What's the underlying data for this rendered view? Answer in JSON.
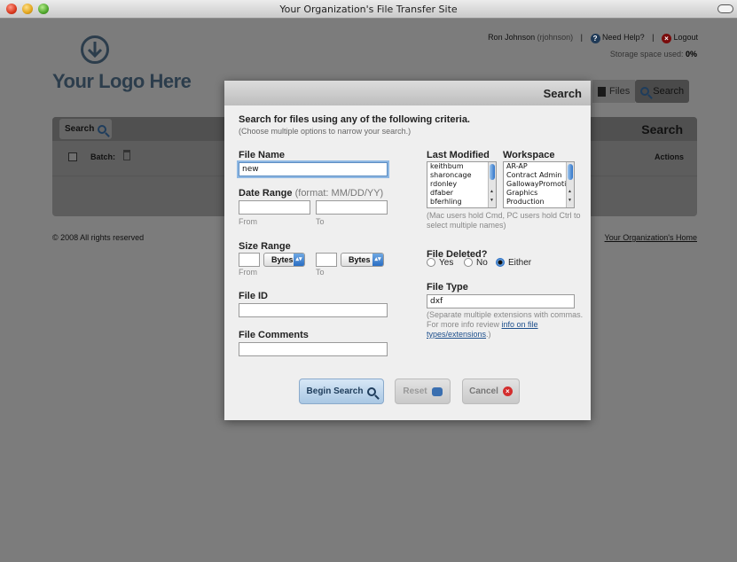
{
  "window": {
    "title": "Your Organization's File Transfer Site"
  },
  "header": {
    "logo_text": "Your Logo Here",
    "user_name": "Ron Johnson",
    "user_handle": "(rjohnson)",
    "help_label": "Need Help?",
    "logout_label": "Logout",
    "storage_label": "Storage space used:",
    "storage_value": "0%"
  },
  "tabs": [
    {
      "label": "Files"
    },
    {
      "label": "Search"
    }
  ],
  "panel": {
    "search_button_label": "Search",
    "title": "Search",
    "batch_label": "Batch:",
    "actions_label": "Actions"
  },
  "footer": {
    "copyright": "© 2008 All rights reserved",
    "home_link": "Your Organization's Home"
  },
  "modal": {
    "title": "Search",
    "intro": "Search for files using any of the following criteria.",
    "intro_sub": "(Choose multiple options to narrow your search.)",
    "file_name": {
      "label": "File Name",
      "value": "new"
    },
    "date_range": {
      "label": "Date Range",
      "hint": "(format: MM/DD/YY)",
      "from_label": "From",
      "to_label": "To",
      "from_value": "",
      "to_value": ""
    },
    "size_range": {
      "label": "Size Range",
      "from_label": "From",
      "to_label": "To",
      "from_value": "",
      "to_value": "",
      "from_unit": "Bytes",
      "to_unit": "Bytes"
    },
    "file_id": {
      "label": "File ID",
      "value": ""
    },
    "file_comments": {
      "label": "File Comments",
      "value": ""
    },
    "last_modified": {
      "label": "Last Modified",
      "options": [
        "keithbum",
        "sharoncage",
        "rdonley",
        "dfaber",
        "bferhling"
      ]
    },
    "workspace": {
      "label": "Workspace",
      "options": [
        "AR-AP",
        "Contract Admin",
        "GallowayPromotion",
        "Graphics",
        "Production"
      ]
    },
    "multi_select_note": "(Mac users hold Cmd, PC users hold Ctrl to select multiple names)",
    "file_deleted": {
      "label": "File Deleted?",
      "options": [
        "Yes",
        "No",
        "Either"
      ],
      "selected": "Either"
    },
    "file_type": {
      "label": "File Type",
      "value": "dxf",
      "note_prefix": "(Separate multiple extensions with commas. For more info review ",
      "note_link": "info on file types/extensions",
      "note_suffix": ".)"
    },
    "buttons": {
      "begin": "Begin Search",
      "reset": "Reset",
      "cancel": "Cancel"
    }
  },
  "colors": {
    "accent": "#2a6ec3",
    "logout": "#d32d2d",
    "brand": "#2c3d4c"
  }
}
